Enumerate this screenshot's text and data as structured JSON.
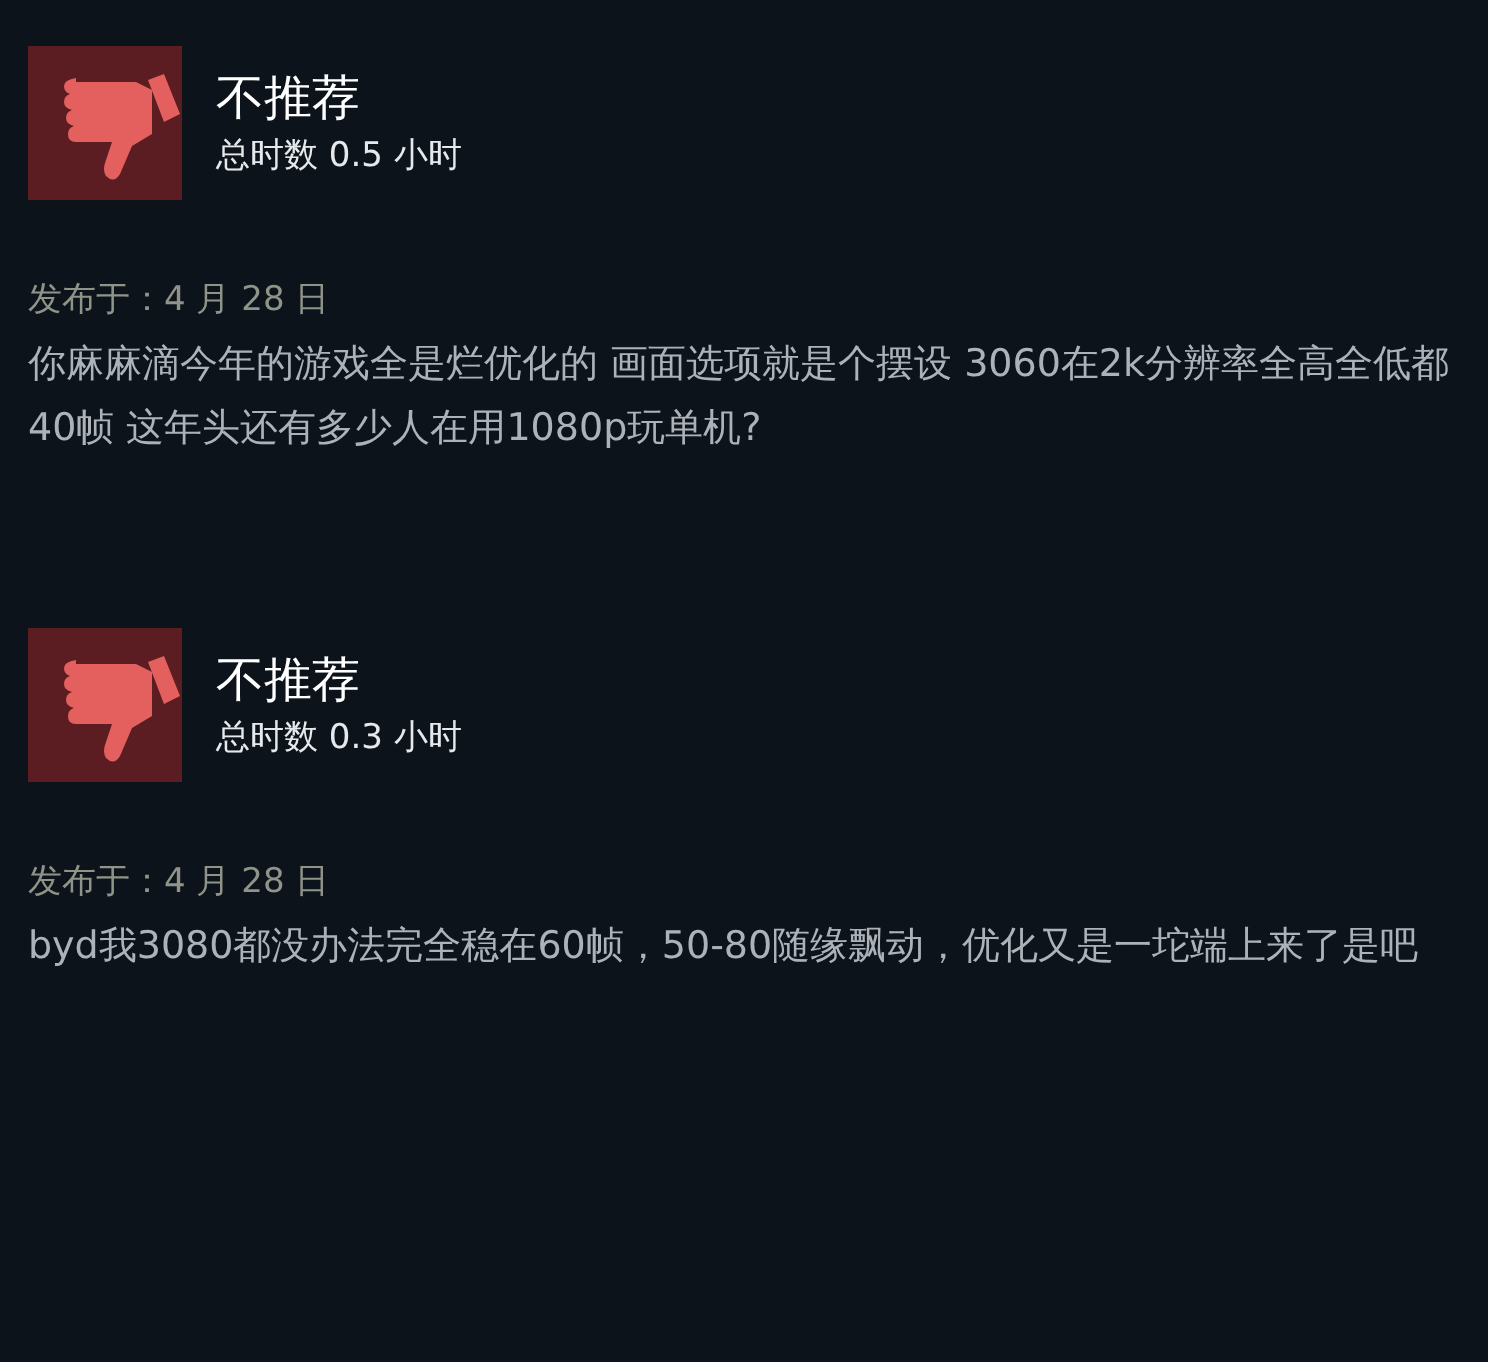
{
  "reviews": [
    {
      "recommended": false,
      "verdict": "不推荐",
      "hours": "总时数 0.5 小时",
      "posted": "发布于：4 月 28 日",
      "text": "你麻麻滴今年的游戏全是烂优化的 画面选项就是个摆设 3060在2k分辨率全高全低都40帧 这年头还有多少人在用1080p玩单机?"
    },
    {
      "recommended": false,
      "verdict": "不推荐",
      "hours": "总时数 0.3 小时",
      "posted": "发布于：4 月 28 日",
      "text": "byd我3080都没办法完全稳在60帧，50-80随缘飘动，优化又是一坨端上来了是吧"
    }
  ]
}
